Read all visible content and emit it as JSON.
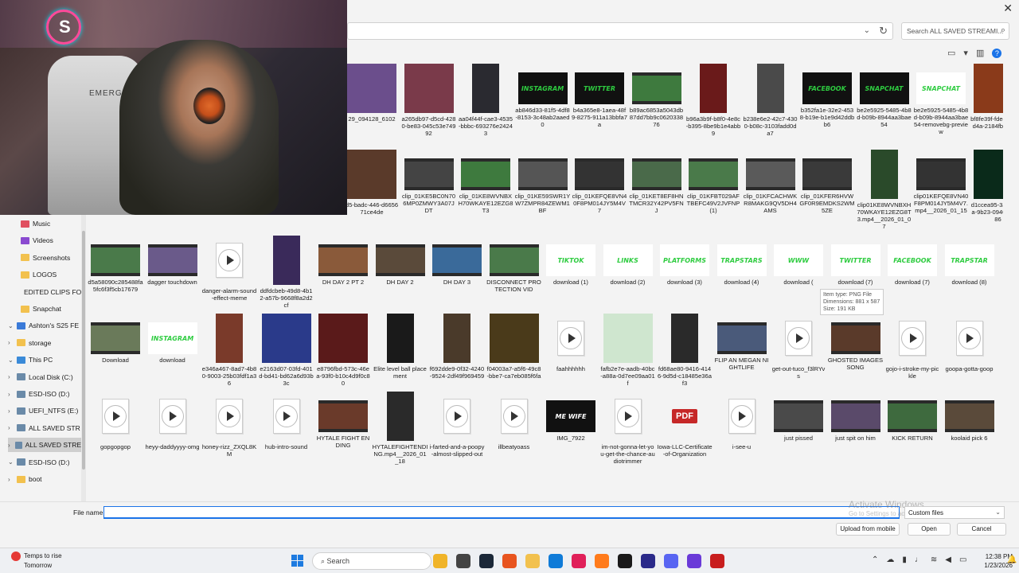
{
  "dialog": {
    "search_placeholder": "Search ALL SAVED STREAMI...",
    "file_name_label": "File name:",
    "file_name_value": "",
    "filter_value": "Custom files",
    "buttons": {
      "upload": "Upload from mobile",
      "open": "Open",
      "cancel": "Cancel"
    },
    "watermark_title": "Activate Windows",
    "watermark_sub": "Go to Settings to activate Windows."
  },
  "webcam": {
    "chair_text": "EMERGE"
  },
  "tooltip": {
    "line1": "Item type: PNG File",
    "line2": "Dimensions: 881 x 587",
    "line3": "Size: 191 KB"
  },
  "sidebar": {
    "items": [
      {
        "label": "Music",
        "icon": "music-icon",
        "color": "#e05060",
        "pin": true
      },
      {
        "label": "Videos",
        "icon": "videos-icon",
        "color": "#8a4ad0",
        "pin": true
      },
      {
        "label": "Screenshots",
        "icon": "folder-icon",
        "color": "#f2c14e"
      },
      {
        "label": "LOGOS",
        "icon": "folder-icon",
        "color": "#f2c14e"
      },
      {
        "label": "EDITED CLIPS FO",
        "icon": "folder-icon",
        "color": "#f2c14e"
      },
      {
        "label": "Snapchat",
        "icon": "folder-icon",
        "color": "#f2c14e"
      },
      {
        "label": "Ashton's S25 FE",
        "icon": "phone-icon",
        "color": "#3a7ad8",
        "arrow": "v"
      },
      {
        "label": "storage",
        "icon": "folder-icon",
        "color": "#f2c14e",
        "arrow": ">"
      },
      {
        "label": "This PC",
        "icon": "pc-icon",
        "color": "#3a8ad8",
        "arrow": "v"
      },
      {
        "label": "Local Disk (C:)",
        "icon": "drive-icon",
        "color": "#6a8aa8",
        "arrow": ">"
      },
      {
        "label": "ESD-ISO (D:)",
        "icon": "drive-icon",
        "color": "#6a8aa8",
        "arrow": ">"
      },
      {
        "label": "UEFI_NTFS (E:)",
        "icon": "drive-icon",
        "color": "#6a8aa8",
        "arrow": ">"
      },
      {
        "label": "ALL SAVED STR",
        "icon": "drive-icon",
        "color": "#6a8aa8",
        "arrow": ">"
      },
      {
        "label": "ALL SAVED STRE",
        "icon": "drive-icon",
        "color": "#6a8aa8",
        "arrow": ">",
        "selected": true
      },
      {
        "label": "ESD-ISO (D:)",
        "icon": "drive-icon",
        "color": "#6a8aa8",
        "arrow": "v"
      },
      {
        "label": "boot",
        "icon": "folder-icon",
        "color": "#f2c14e",
        "arrow": ">"
      }
    ]
  },
  "files": [
    [
      {
        "label": "29_094128_6102",
        "kind": "image",
        "bg": "#6b4e8c"
      },
      {
        "label": "a265db97-d5cd-4280-be83-045c53e74992",
        "kind": "image",
        "bg": "#7a3a4a"
      },
      {
        "label": "aa04f44f-cae3-4535-bbbc-693276e24243",
        "kind": "portrait",
        "bg": "#2a2a30"
      },
      {
        "label": "ab846d33-81f5-4df8-8153-3c48ab2aaed0",
        "kind": "social",
        "text": "INSTAGRAM",
        "fg": "#2ecc40",
        "bg": "#111"
      },
      {
        "label": "b4a365e8-1aea-48f9-8275-911a13bbfa7a",
        "kind": "social",
        "text": "TWITTER",
        "fg": "#2ecc40",
        "bg": "#111"
      },
      {
        "label": "b89ac6853a5043db87dd7bb9c062033876",
        "kind": "video",
        "bg": "#3e7a3e"
      },
      {
        "label": "b96a3b9f-b8f0-4e8c-b395-8be9b1e4abb9",
        "kind": "portrait",
        "bg": "#6a1a1a"
      },
      {
        "label": "b238e6e2-42c7-4300-b08c-3103fadd0da7",
        "kind": "portrait",
        "bg": "#4a4a4a"
      },
      {
        "label": "b352fa1e-32e2-4538-b19e-b1e9d42ddbb6",
        "kind": "social",
        "text": "FACEBOOK",
        "fg": "#2ecc40",
        "bg": "#111"
      },
      {
        "label": "be2e5925-5485-4b8d-b09b-8944aa3bae54",
        "kind": "social",
        "text": "SNAPCHAT",
        "fg": "#2ecc40",
        "bg": "#111"
      },
      {
        "label": "be2e5925-5485-4b8d-b09b-8944aa3bae54-removebg-preview",
        "kind": "social",
        "text": "SNAPCHAT",
        "fg": "#2ecc40",
        "bg": "#fff"
      },
      {
        "label": "bf8fe39f-fde4-410f-8d4a-2184fbe0e9a4",
        "kind": "image",
        "bg": "#8a3a1a"
      }
    ],
    [
      {
        "label": "d5-badc-446-d665671ce4de",
        "kind": "image",
        "bg": "#5a3a2a"
      },
      {
        "label": "clip_01KE5BC0N706MP0ZMWY3A07JDT",
        "kind": "video",
        "bg": "#444"
      },
      {
        "label": "clip_01KE8WVNBXH70WKAYE12EZG8T3",
        "kind": "video",
        "bg": "#3e7a3e"
      },
      {
        "label": "clip_01KE59SWR1YW7ZMPR84ZEWM1BF",
        "kind": "video",
        "bg": "#555"
      },
      {
        "label": "clip_01KEFQE8VN40F8PM014JY5M4V7",
        "kind": "video",
        "bg": "#333"
      },
      {
        "label": "clip_01KET8EF8HNTMCR32Y42PV5FNJ",
        "kind": "video",
        "bg": "#4a6a4a"
      },
      {
        "label": "clip_01KFBT029AFTBEFC49V2JVFNP (1)",
        "kind": "video",
        "bg": "#4a7a4a"
      },
      {
        "label": "clip_01KFCACHWKR8MAKG9QV5DH4AMS",
        "kind": "video",
        "bg": "#5a5a5a"
      },
      {
        "label": "clip_01KFER6HVWGF0R9EMDKS2WM5ZE",
        "kind": "video",
        "bg": "#3a3a3a"
      },
      {
        "label": "clip01KE8WVNBXH70WKAYE12EZG8T3.mp4__2026_01_07",
        "kind": "portrait",
        "bg": "#2a4a2a"
      },
      {
        "label": "clip01KEFQE8VN40F8PM014JY5M4V7.mp4__2026_01_15",
        "kind": "video",
        "bg": "#333"
      },
      {
        "label": "d1ccea95-3a1d-41aa-9b23-09404007f786",
        "kind": "image",
        "bg": "#0a2a1a"
      }
    ],
    [
      {
        "label": "d5a58090c285488fa5fc6f3f5cb17679",
        "kind": "video",
        "bg": "#4a7a4a"
      },
      {
        "label": "dagger touchdown",
        "kind": "video",
        "bg": "#6a5a8a"
      },
      {
        "label": "danger-alarm-sound-effect-meme",
        "kind": "audio"
      },
      {
        "label": "ddfdcbeb-49d8-4b12-a57b-9668f8a2d2cf",
        "kind": "portrait",
        "bg": "#3a2a5a"
      },
      {
        "label": "DH DAY 2 PT 2",
        "kind": "video",
        "bg": "#8a5a3a"
      },
      {
        "label": "DH DAY 2",
        "kind": "video",
        "bg": "#5a4a3a"
      },
      {
        "label": "DH DAY 3",
        "kind": "video",
        "bg": "#3a6a9a"
      },
      {
        "label": "DISCONNECT PROTECTION VID",
        "kind": "video",
        "bg": "#4a7a4a"
      },
      {
        "label": "download (1)",
        "kind": "social",
        "text": "TIKTOK",
        "fg": "#2ecc40",
        "bg": "#fff"
      },
      {
        "label": "download (2)",
        "kind": "social",
        "text": "LINKS",
        "fg": "#2ecc40",
        "bg": "#fff"
      },
      {
        "label": "download (3)",
        "kind": "social",
        "text": "PLATFORMS",
        "fg": "#2ecc40",
        "bg": "#fff"
      },
      {
        "label": "download (4)",
        "kind": "social",
        "text": "TRAPSTARS",
        "fg": "#2ecc40",
        "bg": "#fff"
      },
      {
        "label": "download (",
        "kind": "social",
        "text": "WWW",
        "fg": "#2ecc40",
        "bg": "#fff"
      },
      {
        "label": "download (7)",
        "kind": "social",
        "text": "TWITTER",
        "fg": "#2ecc40",
        "bg": "#fff"
      },
      {
        "label": "download (7)",
        "kind": "social",
        "text": "FACEBOOK",
        "fg": "#2ecc40",
        "bg": "#fff"
      },
      {
        "label": "download (8)",
        "kind": "social",
        "text": "TRAPSTAR",
        "fg": "#2ecc40",
        "bg": "#fff"
      }
    ],
    [
      {
        "label": "Download",
        "kind": "video",
        "bg": "#6a7a5a"
      },
      {
        "label": "download",
        "kind": "social",
        "text": "INSTAGRAM",
        "fg": "#2ecc40",
        "bg": "#fff"
      },
      {
        "label": "e346a467-8ad7-4b80-9003-25b03fdf1a36",
        "kind": "portrait",
        "bg": "#7a3a2a"
      },
      {
        "label": "e2163d07-03fd-401d-bd41-bd62a6d93b3c",
        "kind": "image",
        "bg": "#2a3a8a"
      },
      {
        "label": "e8796fbd-573c-46ea-93f0-b10c4d9f0c80",
        "kind": "image",
        "bg": "#5a1a1a"
      },
      {
        "label": "Elite level ball place ment",
        "kind": "portrait",
        "bg": "#1a1a1a"
      },
      {
        "label": "f692dde9-0f32-4240-9524-2df49f969459",
        "kind": "portrait",
        "bg": "#4a3a2a"
      },
      {
        "label": "f04003a7-a5f6-49c8-bbe7-ca7eb085f6fa",
        "kind": "image",
        "bg": "#4a3a1a"
      },
      {
        "label": "faahhhhhh",
        "kind": "audio"
      },
      {
        "label": "fafb2e7e-aadb-40bc-a88a-0d7ee09aa01f",
        "kind": "image",
        "bg": "#cfe6cf"
      },
      {
        "label": "fd68ae80-9416-4146-9d5d-c18485e36af3",
        "kind": "portrait",
        "bg": "#2a2a2a"
      },
      {
        "label": "FLIP AN MEGAN NIGHTLIFE",
        "kind": "video",
        "bg": "#4a5a7a"
      },
      {
        "label": "get-out-tuco_f3lRYvs",
        "kind": "audio"
      },
      {
        "label": "GHOSTED IMAGES SONG",
        "kind": "video",
        "bg": "#5a3a2a"
      },
      {
        "label": "gojo-i-stroke-my-pickle",
        "kind": "audio"
      },
      {
        "label": "goopa-gotta-goop",
        "kind": "audio"
      }
    ],
    [
      {
        "label": "gopgopgop",
        "kind": "audio"
      },
      {
        "label": "heyy-daddyyyy-omg",
        "kind": "audio"
      },
      {
        "label": "honey-rizz_ZXQL8KM",
        "kind": "audio"
      },
      {
        "label": "hub-intro-sound",
        "kind": "audio"
      },
      {
        "label": "HYTALE FIGHT ENDING",
        "kind": "video",
        "bg": "#6a3a2a"
      },
      {
        "label": "HYTALEFIGHTENDING.mp4__2026_01_18",
        "kind": "portrait",
        "bg": "#2a2a2a"
      },
      {
        "label": "i-farted-and-a-poopy-almost-slipped-out",
        "kind": "audio"
      },
      {
        "label": "illbeatyoass",
        "kind": "audio"
      },
      {
        "label": "IMG_7922",
        "kind": "square",
        "text": "ME WIFE",
        "fg": "#fff",
        "bg": "#111"
      },
      {
        "label": "im-not-gonna-let-you-get-the-chance-audiotrimmer",
        "kind": "audio"
      },
      {
        "label": "Iowa-LLC-Certificate-of-Organization",
        "kind": "pdf"
      },
      {
        "label": "i-see-u",
        "kind": "audio"
      },
      {
        "label": "just pissed",
        "kind": "video",
        "bg": "#4a4a4a"
      },
      {
        "label": "just spit on him",
        "kind": "video",
        "bg": "#5a4a6a"
      },
      {
        "label": "KICK RETURN",
        "kind": "video",
        "bg": "#3e6a3e"
      },
      {
        "label": "koolaid pick 6",
        "kind": "video",
        "bg": "#5a4a3a"
      }
    ]
  ],
  "taskbar": {
    "weather_line1": "Temps to rise",
    "weather_line2": "Tomorrow",
    "search_label": "Search",
    "time": "12:38 PM",
    "date": "1/23/2026",
    "apps": [
      "#f0b429",
      "#444",
      "#1b2838",
      "#e8541f",
      "#f2c14e",
      "#0f7bd8",
      "#e0205a",
      "#ff7b1c",
      "#1a1a1a",
      "#2a2a8a",
      "#5865f2",
      "#6a3ad8",
      "#c81e1e"
    ]
  }
}
